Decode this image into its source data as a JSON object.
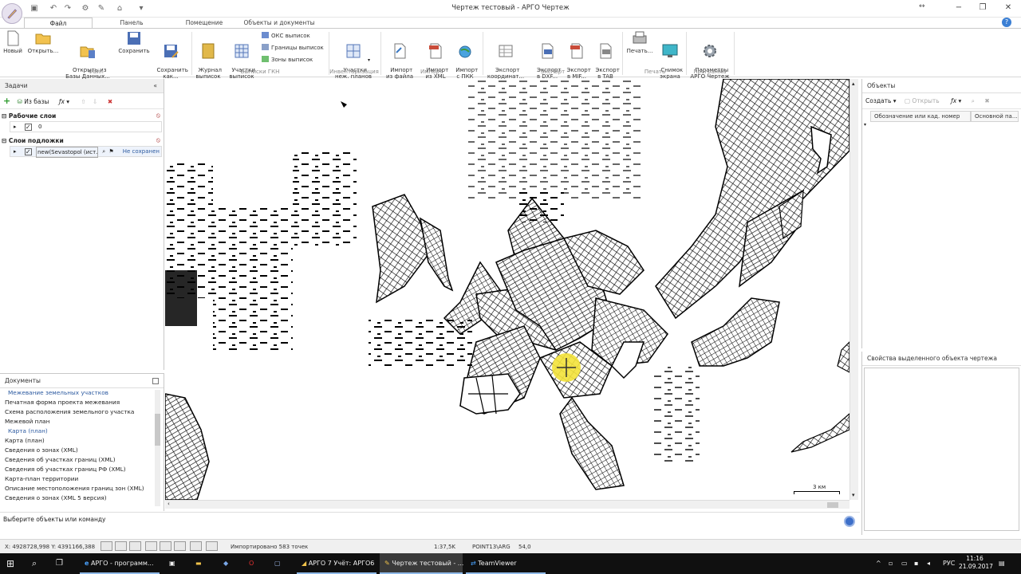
{
  "window": {
    "title": "Чертеж тестовый - АРГО Чертеж",
    "controls": [
      "−",
      "❐",
      "✕"
    ]
  },
  "ribbon": {
    "tabs": [
      "Файл",
      "Панель инструментов",
      "Помещение",
      "Объекты и документы"
    ],
    "groups": [
      {
        "name": "Файл",
        "buttons": [
          "Новый",
          "Открыть...",
          "Открыть из\nБазы Данных...",
          "Сохранить",
          "Сохранить\nкак..."
        ]
      },
      {
        "name": "Выписки ГКН",
        "buttons": [
          "Журнал\nвыписок",
          "Участки\nвыписок"
        ],
        "small": [
          "ОКС выписок",
          "Границы выписок",
          "Зоны выписок"
        ]
      },
      {
        "name": "Инвентаризация",
        "buttons": [
          "Участки\nнеж. планов"
        ]
      },
      {
        "name": "Импорт",
        "buttons": [
          "Импорт\nиз файла",
          "Импорт\nиз XML",
          "Импорт\nс ПКК"
        ]
      },
      {
        "name": "Экспорт",
        "buttons": [
          "Экспорт\nкоординат...",
          "Экспорт\nв DXF...",
          "Экспорт\nв MIF...",
          "Экспорт\nв TAB"
        ]
      },
      {
        "name": "Печать",
        "buttons": [
          "Печать...",
          "Снимок\nэкрана"
        ]
      },
      {
        "name": "Программа",
        "buttons": [
          "Параметры\nАРГО Чертеж"
        ]
      }
    ]
  },
  "tasks": {
    "title": "Задачи",
    "from_db": "Из базы",
    "working_layers": "Рабочие слои",
    "working_layer_value": "0",
    "base_layers": "Слои подложки",
    "base_layer_name": "new(Sevastopol (ист...",
    "base_layer_status": "Не сохранен"
  },
  "documents": {
    "title": "Документы",
    "sections": [
      {
        "heading": "Межевание земельных участков",
        "items": [
          "Печатная форма проекта межевания",
          "Схема расположения земельного участка",
          "Межевой план"
        ]
      },
      {
        "heading": "Карта (план)",
        "items": [
          "Карта (план)",
          "Сведения о зонах (XML)",
          "Сведения об участках границ (XML)",
          "Сведения об участках границ РФ (XML)",
          "Карта-план территории",
          "Описание местоположения границ зон (XML)",
          "Сведения о зонах (XML 5 версия)"
        ]
      }
    ]
  },
  "objects": {
    "title": "Объекты",
    "create": "Создать",
    "open": "Открыть",
    "columns": [
      "Обозначение или кад. номер",
      "Основной па..."
    ]
  },
  "properties": {
    "title": "Свойства выделенного объекта чертежа"
  },
  "map": {
    "scale_label": "3 км"
  },
  "command": {
    "prompt": "Выберите объекты или команду"
  },
  "status": {
    "coords": "X: 4928728,998 Y: 4391166,388",
    "imported": "Импортировано 583 точек",
    "scale": "1:37,5K",
    "cs": "POINT13\\ARG",
    "value": "54,0"
  },
  "taskbar": {
    "items": [
      "АРГО - программ...",
      "АРГО 7 Учёт: АРГО6",
      "Чертеж тестовый - ...",
      "TeamViewer"
    ],
    "lang": "РУС",
    "time": "11:16",
    "date": "21.09.2017"
  }
}
